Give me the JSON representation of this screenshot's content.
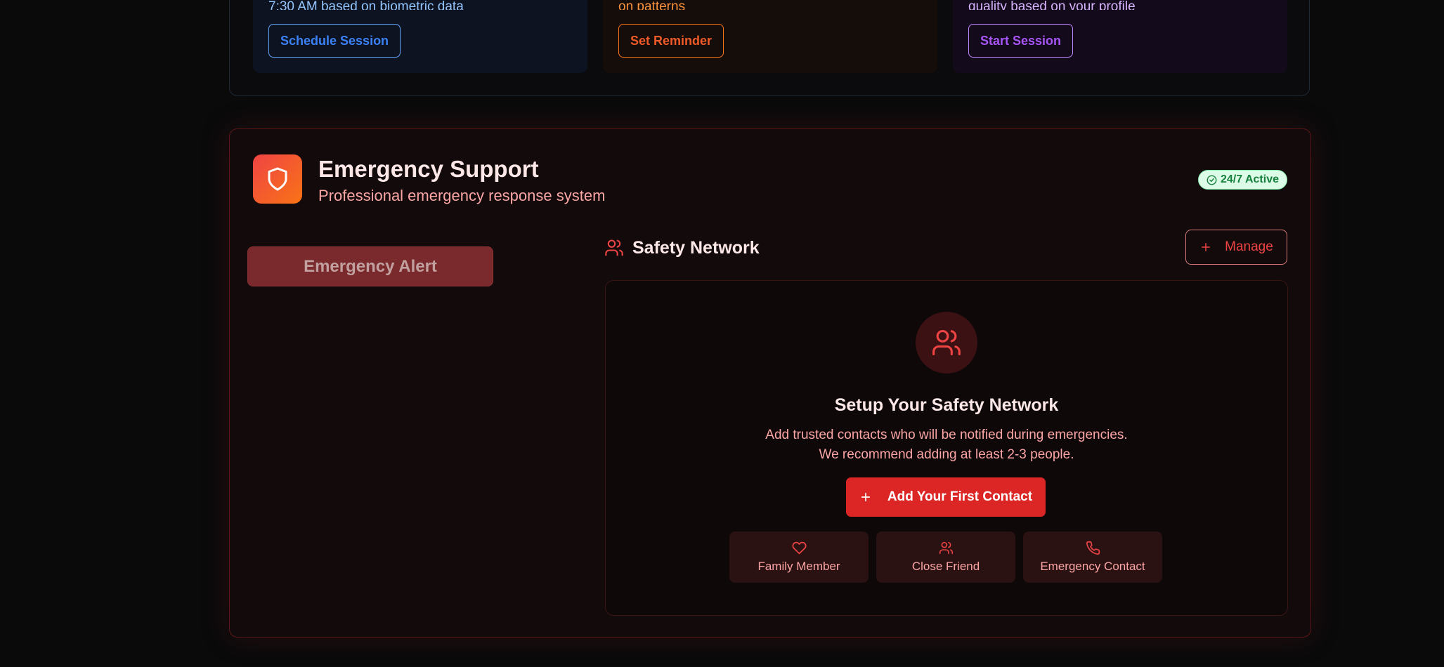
{
  "top_cards": [
    {
      "description": "7:30 AM based on biometric data",
      "button_label": "Schedule Session"
    },
    {
      "description": "on patterns",
      "button_label": "Set Reminder"
    },
    {
      "description": "quality based on your profile",
      "button_label": "Start Session"
    }
  ],
  "emergency": {
    "title": "Emergency Support",
    "subtitle": "Professional emergency response system",
    "badge": "24/7 Active",
    "alert_button": "Emergency Alert"
  },
  "safety_network": {
    "title": "Safety Network",
    "manage_label": "Manage",
    "setup_heading": "Setup Your Safety Network",
    "setup_desc_line1": "Add trusted contacts who will be notified during emergencies.",
    "setup_desc_line2": "We recommend adding at least 2-3 people.",
    "add_button": "Add Your First Contact",
    "contact_types": [
      {
        "label": "Family Member",
        "icon": "heart-icon"
      },
      {
        "label": "Close Friend",
        "icon": "users-icon"
      },
      {
        "label": "Emergency Contact",
        "icon": "phone-icon"
      }
    ]
  },
  "colors": {
    "page_bg": "#0a0a0b",
    "accent_red": "#dc2626",
    "badge_green": "#15803d",
    "blue": "#3b82f6",
    "orange": "#f05a28",
    "purple": "#a855f7"
  }
}
